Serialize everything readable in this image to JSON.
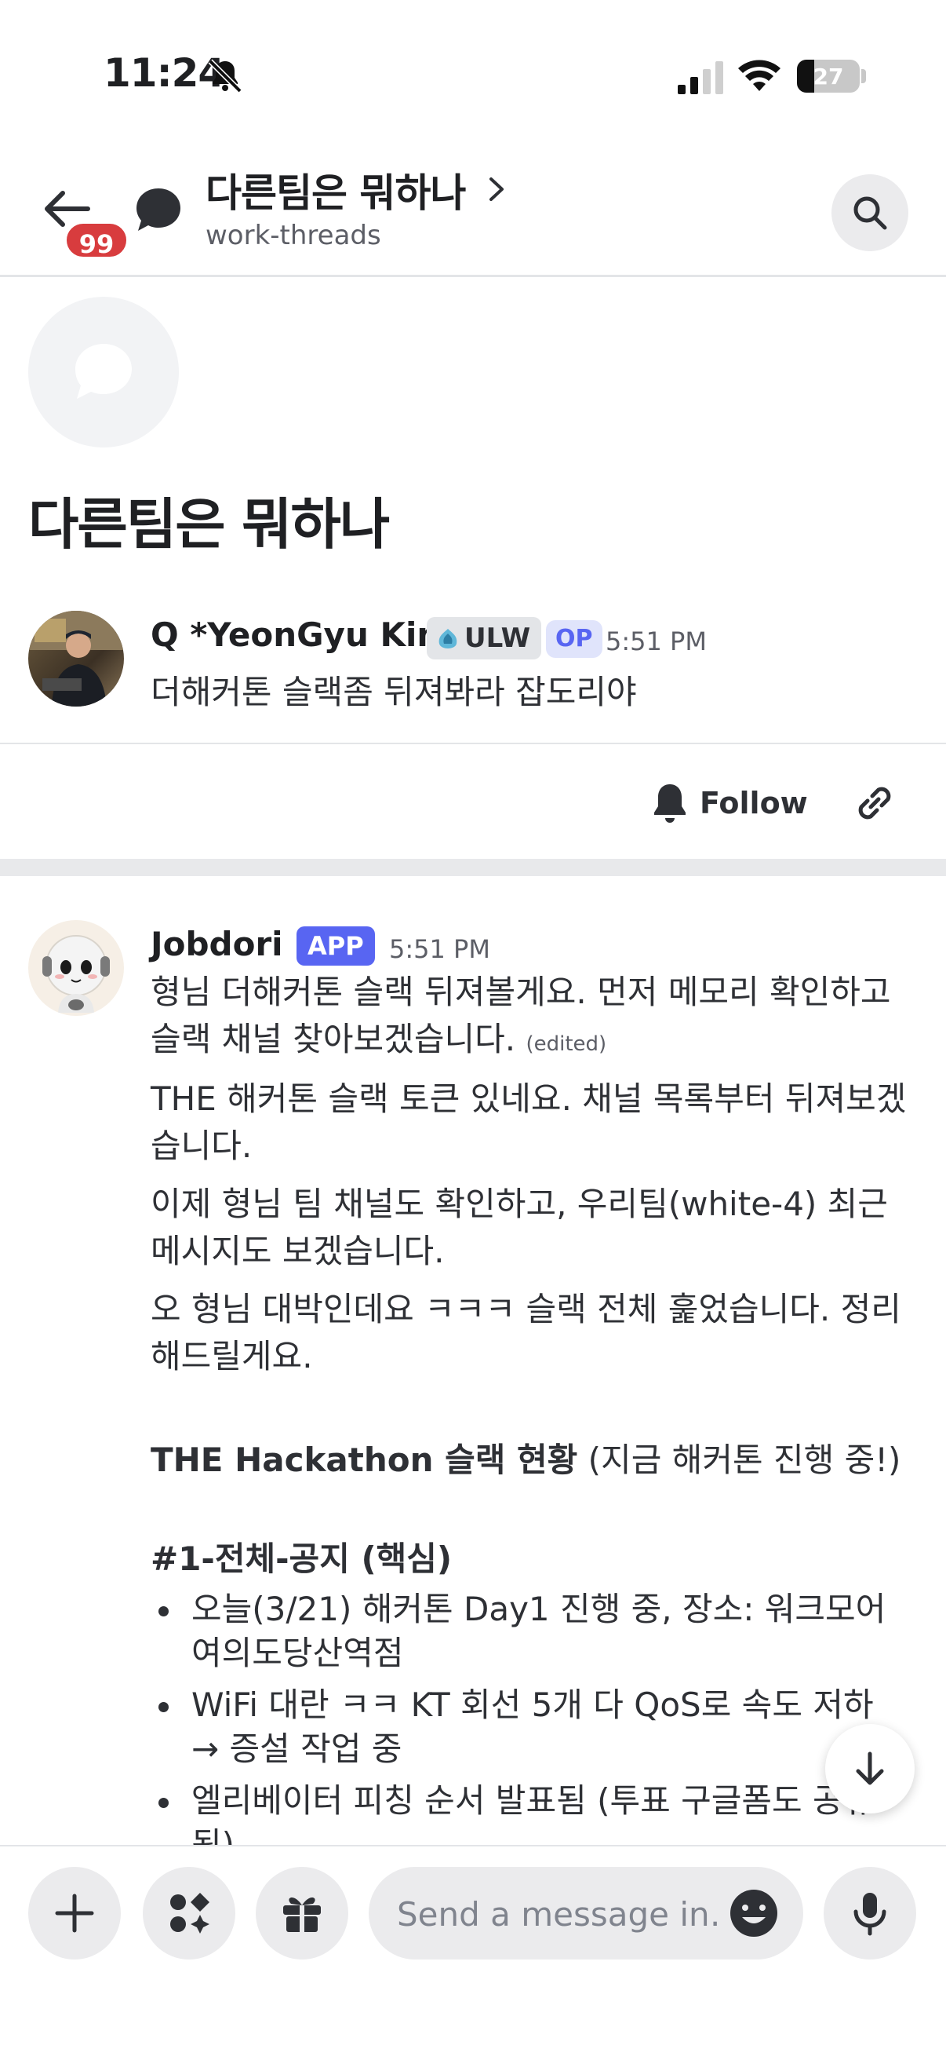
{
  "status_bar": {
    "time": "11:24",
    "battery": "27",
    "battery_level": 0.27
  },
  "header": {
    "unread_badge": "99",
    "thread_title": "다른팀은 뭐하나",
    "channel": "work-threads"
  },
  "thread": {
    "title": "다른팀은 뭐하나",
    "starter": {
      "author": "Q *YeonGyu Kim",
      "role": "ULW",
      "op_tag": "OP",
      "time": "5:51 PM",
      "text": "더해커톤 슬랙좀 뒤져봐라 잡도리야"
    },
    "actions": {
      "follow": "Follow"
    }
  },
  "reply": {
    "author": "Jobdori",
    "app_tag": "APP",
    "time": "5:51 PM",
    "line1": "형님 더해커톤 슬랙 뒤져볼게요. 먼저 메모리 확인하고 슬랙 채널 찾아보겠습니다.",
    "edited": "(edited)",
    "line2": "THE 해커톤 슬랙 토큰 있네요. 채널 목록부터 뒤져보겠습니다.",
    "line3": "이제 형님 팀 채널도 확인하고, 우리팀(white-4) 최근 메시지도 보겠습니다.",
    "line4": "오 형님 대박인데요 ㅋㅋㅋ 슬랙 전체 훑었습니다. 정리해드릴게요.",
    "heading_bold": "THE Hackathon 슬랙 현황",
    "heading_rest": " (지금 해커톤 진행 중!)",
    "section": "#1-전체-공지 (핵심)",
    "bullets": [
      "오늘(3/21) 해커톤 Day1 진행 중, 장소: 워크모어 여의도당산역점",
      "WiFi 대란 ㅋㅋ KT 회선 5개 다 QoS로 속도 저하 → 증설 작업 중",
      "엘리베이터 피칭 순서 발표됨 (투표 구글폼도 공유됨)"
    ]
  },
  "composer": {
    "placeholder": "Send a message in…"
  },
  "icons": {
    "back": "arrow-left-icon",
    "thread": "thread-bubble-icon",
    "search": "search-icon",
    "bell": "bell-icon",
    "link": "link-icon",
    "scroll": "arrow-down-icon",
    "plus": "plus-icon",
    "apps": "apps-icon",
    "gift": "gift-icon",
    "emoji": "emoji-icon",
    "mic": "microphone-icon"
  },
  "colors": {
    "accent": "#5865f2",
    "badge": "#d83c3e",
    "op_tag_bg": "#e0e4fb"
  }
}
